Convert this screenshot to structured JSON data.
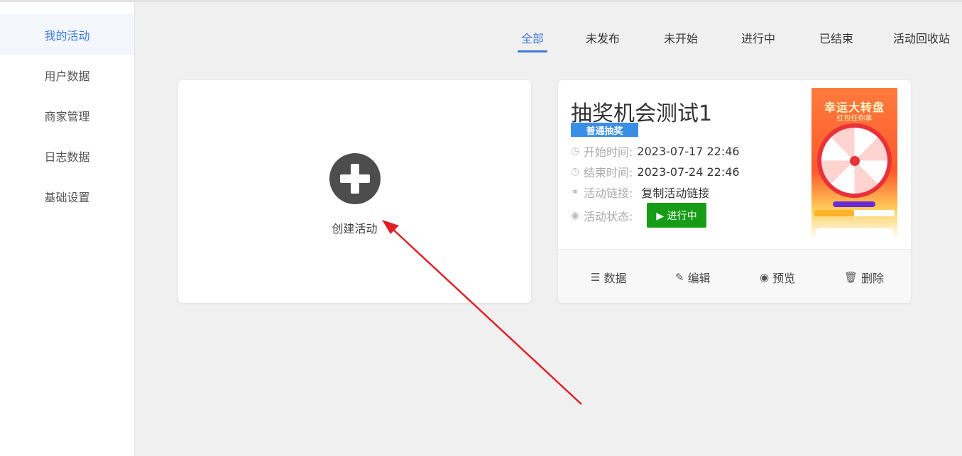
{
  "sidebar": {
    "items": [
      {
        "label": "我的活动"
      },
      {
        "label": "用户数据"
      },
      {
        "label": "商家管理"
      },
      {
        "label": "日志数据"
      },
      {
        "label": "基础设置"
      }
    ]
  },
  "tabs": {
    "items": [
      {
        "label": "全部"
      },
      {
        "label": "未发布"
      },
      {
        "label": "未开始"
      },
      {
        "label": "进行中"
      },
      {
        "label": "已结束"
      },
      {
        "label": "活动回收站"
      }
    ]
  },
  "create": {
    "label": "创建活动",
    "icon": "plus-circle-icon"
  },
  "activity": {
    "title": "抽奖机会测试1",
    "tag": "普通抽奖",
    "start_label": "开始时间:",
    "start_value": "2023-07-17 22:46",
    "end_label": "结束时间:",
    "end_value": "2023-07-24 22:46",
    "link_label": "活动链接:",
    "link_value": "复制活动链接",
    "status_label": "活动状态:",
    "status_value": "▶ 进行中",
    "poster": {
      "title": "幸运大转盘",
      "subtitle": "红包任你拿"
    },
    "actions": {
      "data": "数据",
      "edit": "编辑",
      "preview": "预览",
      "delete": "删除"
    }
  },
  "colors": {
    "accent": "#3e7bd6",
    "tag": "#3a8ee6",
    "status_green": "#169c16",
    "annotation_arrow": "#e01f26"
  }
}
